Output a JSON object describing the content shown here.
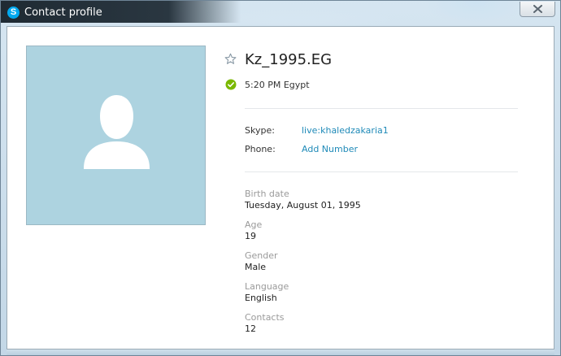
{
  "window": {
    "title": "Contact profile",
    "app_icon_letter": "S"
  },
  "contact": {
    "name": "Kz_1995.EG",
    "local_time": "5:20 PM Egypt",
    "skype_label": "Skype:",
    "skype_value": "live:khaledzakaria1",
    "phone_label": "Phone:",
    "phone_action": "Add Number"
  },
  "fields": [
    {
      "label": "Birth date",
      "value": "Tuesday, August 01, 1995"
    },
    {
      "label": "Age",
      "value": "19"
    },
    {
      "label": "Gender",
      "value": "Male"
    },
    {
      "label": "Language",
      "value": "English"
    },
    {
      "label": "Contacts",
      "value": "12"
    }
  ],
  "colors": {
    "link": "#1f8ab8",
    "status_online": "#7ab800",
    "avatar_bg": "#add3e0"
  },
  "icons": {
    "app": "skype-logo-icon",
    "favorite": "star-outline-icon",
    "status": "online-check-icon",
    "close": "close-icon",
    "avatar": "default-avatar-icon"
  }
}
